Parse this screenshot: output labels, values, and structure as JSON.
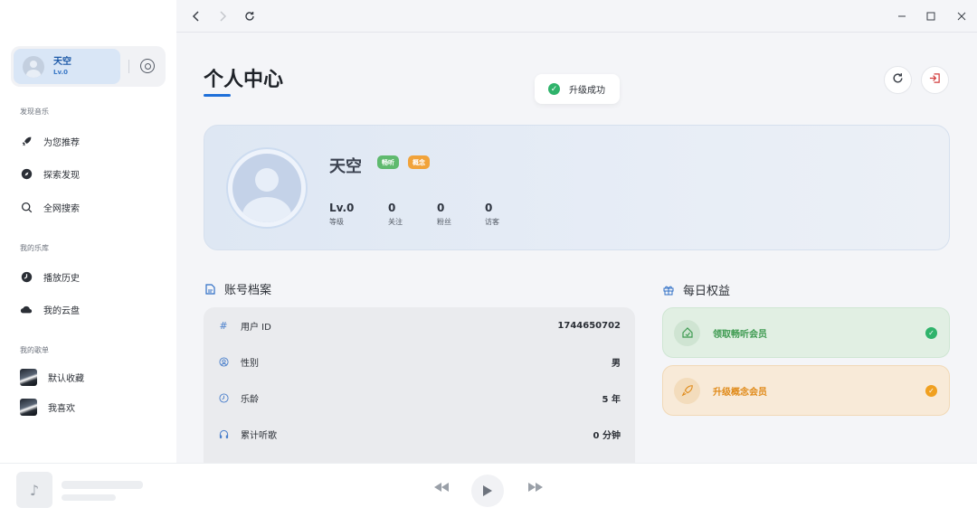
{
  "sidebar": {
    "user": {
      "name": "天空",
      "level": "Lv.0"
    },
    "sections": [
      {
        "title": "发现音乐",
        "items": [
          {
            "label": "为您推荐",
            "icon": "rocket-icon"
          },
          {
            "label": "探索发现",
            "icon": "compass-icon"
          },
          {
            "label": "全网搜索",
            "icon": "search-icon"
          }
        ]
      },
      {
        "title": "我的乐库",
        "items": [
          {
            "label": "播放历史",
            "icon": "clock-icon"
          },
          {
            "label": "我的云盘",
            "icon": "cloud-icon"
          }
        ]
      },
      {
        "title": "我的歌单",
        "items": [
          {
            "label": "默认收藏",
            "icon": "playlist-cover"
          },
          {
            "label": "我喜欢",
            "icon": "playlist-cover"
          }
        ]
      }
    ]
  },
  "topbar": {
    "back_icon": "chevron-left-icon",
    "forward_icon": "chevron-right-icon",
    "refresh_icon": "refresh-icon",
    "window_controls": [
      "minimize-icon",
      "maximize-icon",
      "close-icon"
    ]
  },
  "main": {
    "page_title": "个人中心",
    "toast": "升级成功",
    "profile": {
      "name": "天空",
      "badges": [
        "畅听",
        "概念"
      ],
      "stats": [
        {
          "value": "Lv.0",
          "label": "等级"
        },
        {
          "value": "0",
          "label": "关注"
        },
        {
          "value": "0",
          "label": "粉丝"
        },
        {
          "value": "0",
          "label": "访客"
        }
      ]
    },
    "account": {
      "title": "账号档案",
      "rows": [
        {
          "label": "用户 ID",
          "value": "1744650702",
          "icon": "hash-icon"
        },
        {
          "label": "性别",
          "value": "男",
          "icon": "user-circle-icon"
        },
        {
          "label": "乐龄",
          "value": "5 年",
          "icon": "clock-icon"
        },
        {
          "label": "累计听歌",
          "value": "0 分钟",
          "icon": "headphones-icon"
        }
      ]
    },
    "benefits": {
      "title": "每日权益",
      "items": [
        {
          "label": "领取畅听会员",
          "color": "#3d9a50"
        },
        {
          "label": "升级概念会员",
          "color": "#e08a18"
        }
      ]
    }
  },
  "player": {
    "controls": [
      "previous-icon",
      "play-icon",
      "next-icon"
    ]
  }
}
